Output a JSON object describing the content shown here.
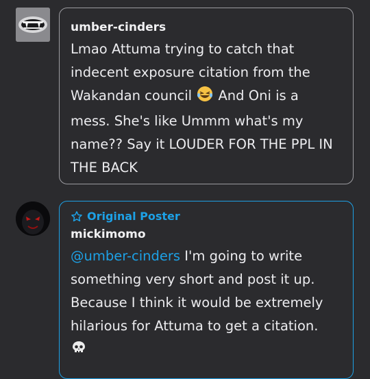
{
  "comments": [
    {
      "username": "umber-cinders",
      "avatar_icon": "vampire-fangs-icon",
      "text_before_emoji": "Lmao Attuma trying to catch that indecent exposure citation from the Wakandan council ",
      "emoji": "laughing-emoji-icon",
      "text_after_emoji": " And Oni is a mess. She's like Ummm what's my name?? Say it LOUDER FOR THE PPL IN THE BACK"
    },
    {
      "badge_label": "Original Poster",
      "badge_icon": "star-outline-icon",
      "username": "mickimomo",
      "avatar_icon": "red-eyed-figure-icon",
      "mention": "@umber-cinders",
      "text": " I'm going to write something very short and post it up. Because I think it would be extremely hilarious for Attuma to get a citation.",
      "trailing_emoji": "skull-emoji-icon"
    }
  ],
  "colors": {
    "background": "#2b2b2e",
    "bubble_border": "#9c9ca1",
    "op_accent": "#1da1e6",
    "text": "#ececef"
  }
}
